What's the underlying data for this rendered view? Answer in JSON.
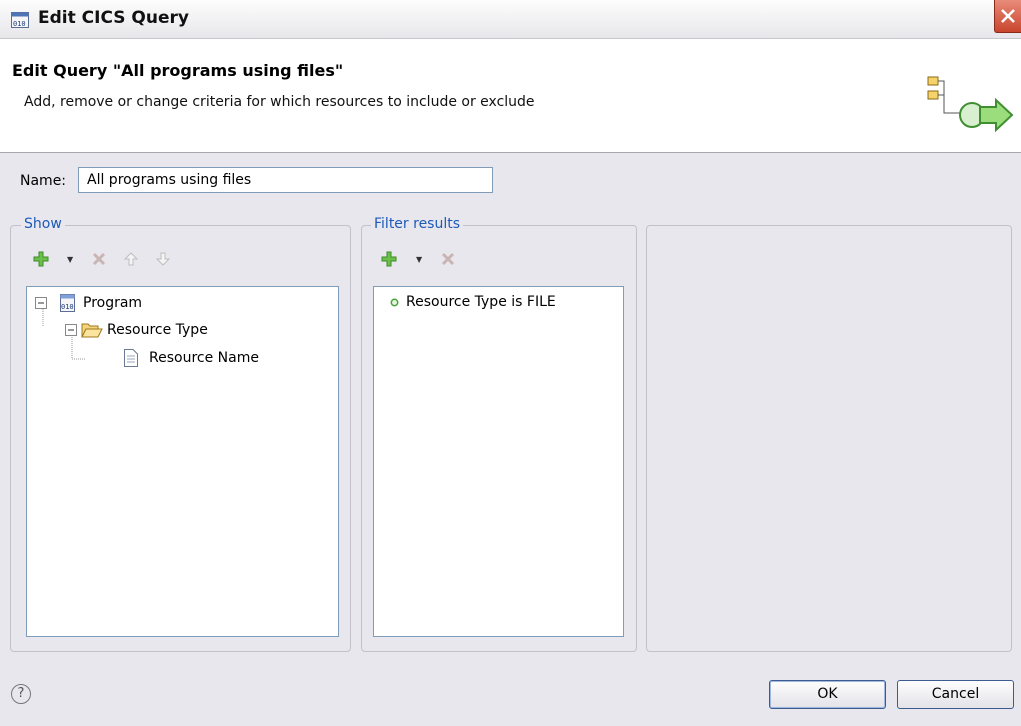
{
  "window": {
    "title": "Edit CICS Query"
  },
  "header": {
    "heading": "Edit Query \"All programs using files\"",
    "description": "Add, remove or change criteria for which resources to include or exclude"
  },
  "name_field": {
    "label": "Name:",
    "value": "All programs using files"
  },
  "show_group": {
    "legend": "Show",
    "toolbar": [
      "add-icon",
      "dropdown-arrow",
      "remove-icon",
      "move-up-icon",
      "move-down-icon"
    ],
    "tree": [
      {
        "label": "Program",
        "icon": "program-icon",
        "expanded": true
      },
      {
        "label": "Resource Type",
        "icon": "folder-open-icon",
        "expanded": true
      },
      {
        "label": "Resource Name",
        "icon": "document-icon"
      }
    ]
  },
  "filter_group": {
    "legend": "Filter results",
    "toolbar": [
      "add-icon",
      "dropdown-arrow",
      "remove-icon"
    ],
    "items": [
      {
        "label": "Resource Type is FILE",
        "icon": "bullet-icon"
      }
    ]
  },
  "buttons": {
    "ok": "OK",
    "cancel": "Cancel"
  },
  "colors": {
    "legend": "#1c5ab8",
    "close": "#c9452d",
    "add": "#4aa23a"
  }
}
